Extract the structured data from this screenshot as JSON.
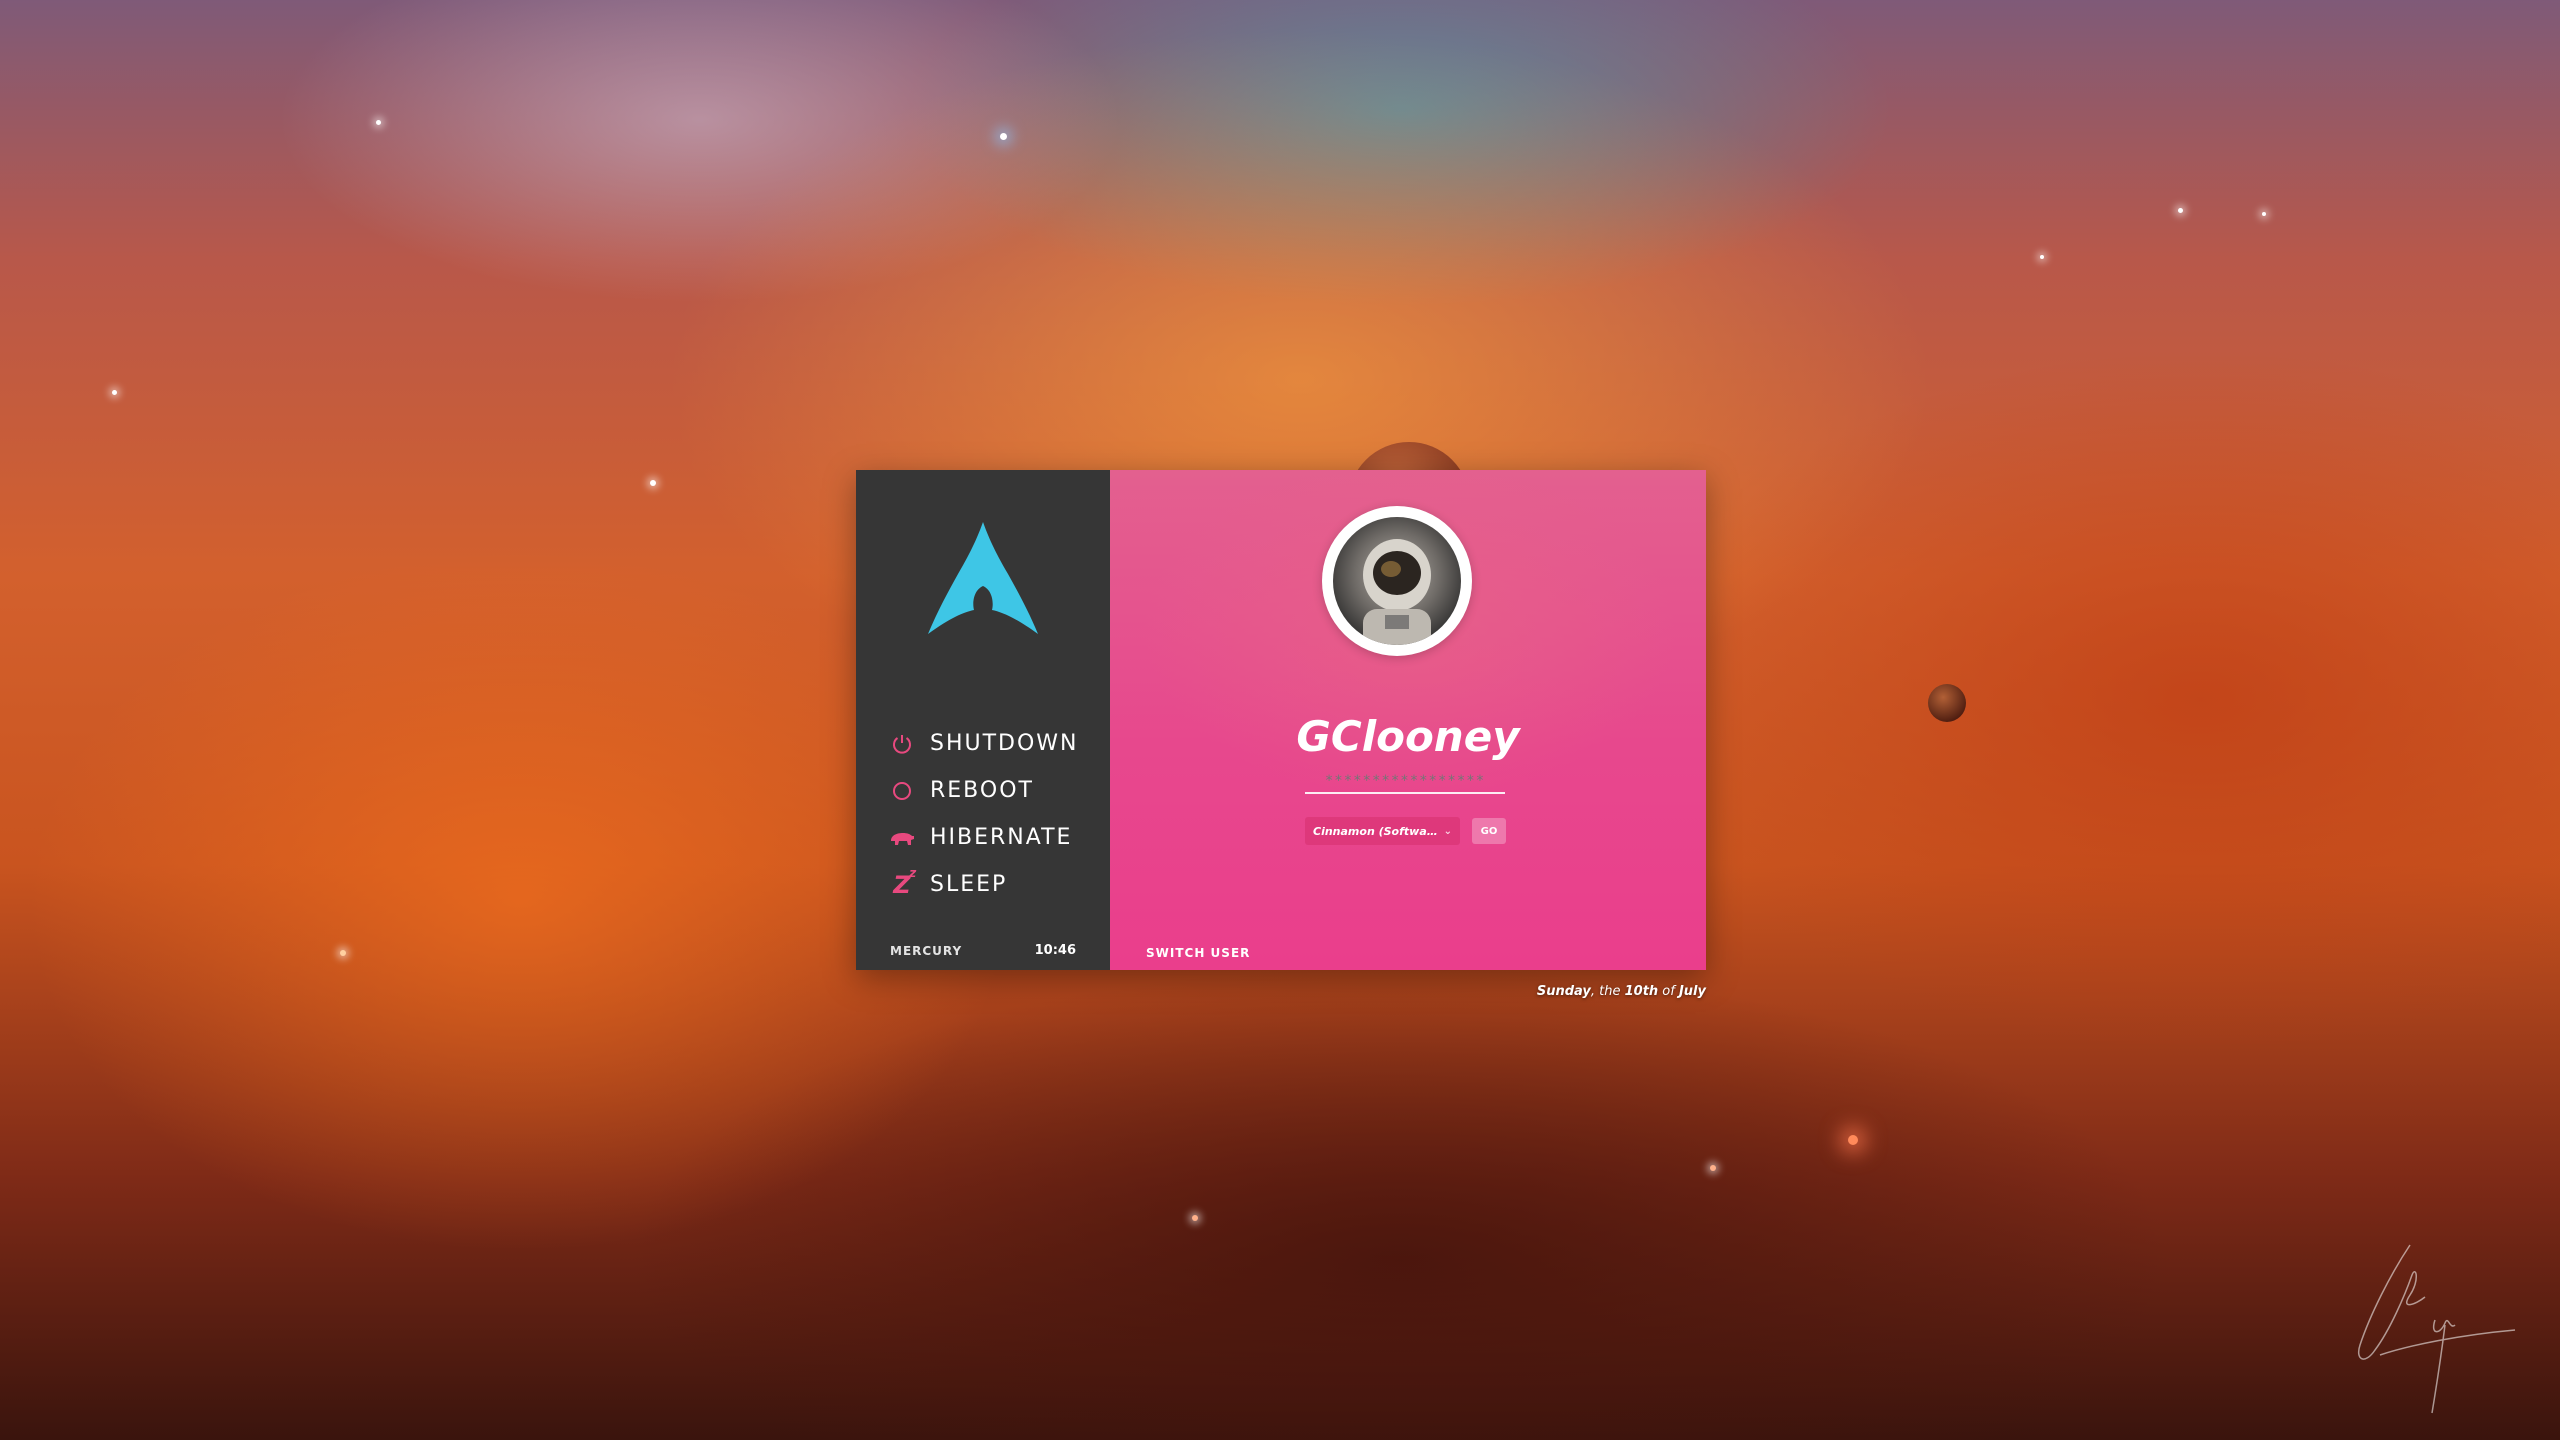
{
  "background": {
    "description_colors": {
      "nebula_orange": "#d3602d",
      "nebula_teal": "#5a9aa8",
      "deep_red": "#3a140d"
    }
  },
  "sidebar": {
    "logo_icon": "arch-linux-logo-icon",
    "accent_color": "#3ec6e6",
    "power_options": [
      {
        "label": "SHUTDOWN",
        "icon": "power-icon"
      },
      {
        "label": "REBOOT",
        "icon": "reboot-circle-icon"
      },
      {
        "label": "HIBERNATE",
        "icon": "bear-icon"
      },
      {
        "label": "SLEEP",
        "icon": "zz-sleep-icon"
      }
    ],
    "hostname": "MERCURY",
    "clock": "10:46"
  },
  "login": {
    "username": "GClooney",
    "password_mask": "*****************",
    "session": "Cinnamon (Softwa…",
    "go_label": "GO",
    "switch_user_label": "SWITCH USER",
    "panel_color": "#e7488d"
  },
  "date": {
    "weekday": "Sunday",
    "the": ", the ",
    "day": "10th",
    "of": " of ",
    "month": "July"
  }
}
